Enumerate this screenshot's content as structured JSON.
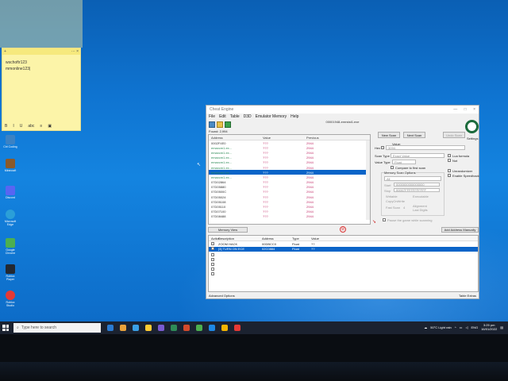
{
  "sticky": {
    "lines": [
      "wschoftr123",
      "mmonline123|"
    ],
    "format_buttons": [
      "B",
      "I",
      "U",
      "abc",
      "≡",
      "▣"
    ],
    "menu_glyph": "···",
    "close_glyph": "×",
    "add_glyph": "+"
  },
  "desktop_icons": [
    {
      "label": "Ctrl Coding",
      "color": "#3b82c4"
    },
    {
      "label": "Minecraft",
      "color": "#8b5a2b"
    },
    {
      "label": "Discord",
      "color": "#5865f2"
    },
    {
      "label": "Microsoft Edge",
      "color": "#2b9fd8"
    },
    {
      "label": "Google Chrome",
      "color": "#4caf50"
    },
    {
      "label": "Roblox Player",
      "color": "#222831"
    },
    {
      "label": "Roblox Studio",
      "color": "#e53935"
    }
  ],
  "ce": {
    "title": "Cheat Engine",
    "window_controls": [
      "—",
      "□",
      "×"
    ],
    "menu": [
      "File",
      "Edit",
      "Table",
      "D3D",
      "Emulator Memory",
      "Help"
    ],
    "process": "00001948-emrstst1.exe",
    "found": "Found: 2,994",
    "scan_headers": [
      "Address",
      "Value",
      "Previous"
    ],
    "scan_rows": [
      {
        "address": "0002F4E0",
        "value": "???",
        "previous": "2944",
        "color": "normal",
        "selected": false
      },
      {
        "address": "emaxcm1.ex...",
        "value": "???",
        "previous": "2944",
        "color": "green",
        "selected": false
      },
      {
        "address": "emaxcm1.ex...",
        "value": "???",
        "previous": "2944",
        "color": "green",
        "selected": false
      },
      {
        "address": "emaxcm1.ex...",
        "value": "???",
        "previous": "2944",
        "color": "green",
        "selected": false
      },
      {
        "address": "emaxcm1.ex...",
        "value": "???",
        "previous": "2944",
        "color": "green",
        "selected": false
      },
      {
        "address": "emaxcm1.ex...",
        "value": "???",
        "previous": "2944",
        "color": "green",
        "selected": false
      },
      {
        "address": "emaxcm1.ex...",
        "value": "???",
        "previous": "2944",
        "color": "green",
        "selected": true
      },
      {
        "address": "emaxcm1.ex...",
        "value": "???",
        "previous": "2944",
        "color": "green",
        "selected": false
      },
      {
        "address": "07D02864",
        "value": "???",
        "previous": "2944",
        "color": "normal",
        "selected": false
      },
      {
        "address": "07D05880",
        "value": "???",
        "previous": "2944",
        "color": "normal",
        "selected": false
      },
      {
        "address": "07D0500C",
        "value": "???",
        "previous": "2944",
        "color": "normal",
        "selected": false
      },
      {
        "address": "07D05024",
        "value": "???",
        "previous": "2944",
        "color": "normal",
        "selected": false
      },
      {
        "address": "07D05108",
        "value": "???",
        "previous": "2944",
        "color": "normal",
        "selected": false
      },
      {
        "address": "07D05110",
        "value": "???",
        "previous": "2944",
        "color": "normal",
        "selected": false
      },
      {
        "address": "07D07100",
        "value": "???",
        "previous": "2944",
        "color": "normal",
        "selected": false
      },
      {
        "address": "07D08488",
        "value": "???",
        "previous": "2944",
        "color": "normal",
        "selected": false
      }
    ],
    "new_scan": "New Scan",
    "next_scan": "Next Scan",
    "undo_scan": "Undo Scan",
    "settings": "Settings",
    "value_label": "Value:",
    "hex_label": "Hex",
    "hex_value": "3094",
    "scan_type_label": "Scan Type",
    "scan_type": "Exact Value",
    "value_type_label": "Value Type",
    "value_type": "Float",
    "compare_first": "Compare to first scan",
    "lua_formula": "Lua formula",
    "not_label": "Not",
    "unrandomizer": "Unrandomizer",
    "speedhack": "Enable Speedhack",
    "mem_scan_options": "Memory Scan Options",
    "mem_region": "All",
    "start_label": "Start",
    "start_value": "0000000000000000",
    "stop_label": "Stop",
    "stop_value": "00007FFFFFFFFFFF",
    "writable": "Writable",
    "executable": "Executable",
    "copy_on_write": "CopyOnWrite",
    "fast_scan": "Fast Scan",
    "fast_scan_value": "4",
    "alignment": "Alignment",
    "last_digits": "Last Digits",
    "pause_game": "Pause the game while scanning",
    "memory_view": "Memory View",
    "add_manually": "Add Address Manually",
    "addr_headers": [
      "Active",
      "Description",
      "Address",
      "Type",
      "Value"
    ],
    "addr_rows": [
      {
        "description": "ZOOM HACK",
        "address": "00DBCC0",
        "type": "Float",
        "value": "??",
        "selected": false
      },
      {
        "description": "[3] TURN ON ECE",
        "address": "02C0884",
        "type": "Float",
        "value": "??",
        "selected": true
      }
    ],
    "advanced_options": "Advanced Options",
    "table_extras": "Table Extras"
  },
  "taskbar": {
    "search_placeholder": "Type here to search",
    "weather": "50°C  Light rain",
    "lang": "ENG",
    "time": "3:25 pm",
    "date": "16/01/2022",
    "apps": [
      "#2a7bd2",
      "#e9a23b",
      "#3aa0e6",
      "#ffcc33",
      "#7a5bd1",
      "#2e8b57",
      "#d34a2c",
      "#4caf50",
      "#1e88e5",
      "#f4b400",
      "#e53935"
    ]
  }
}
